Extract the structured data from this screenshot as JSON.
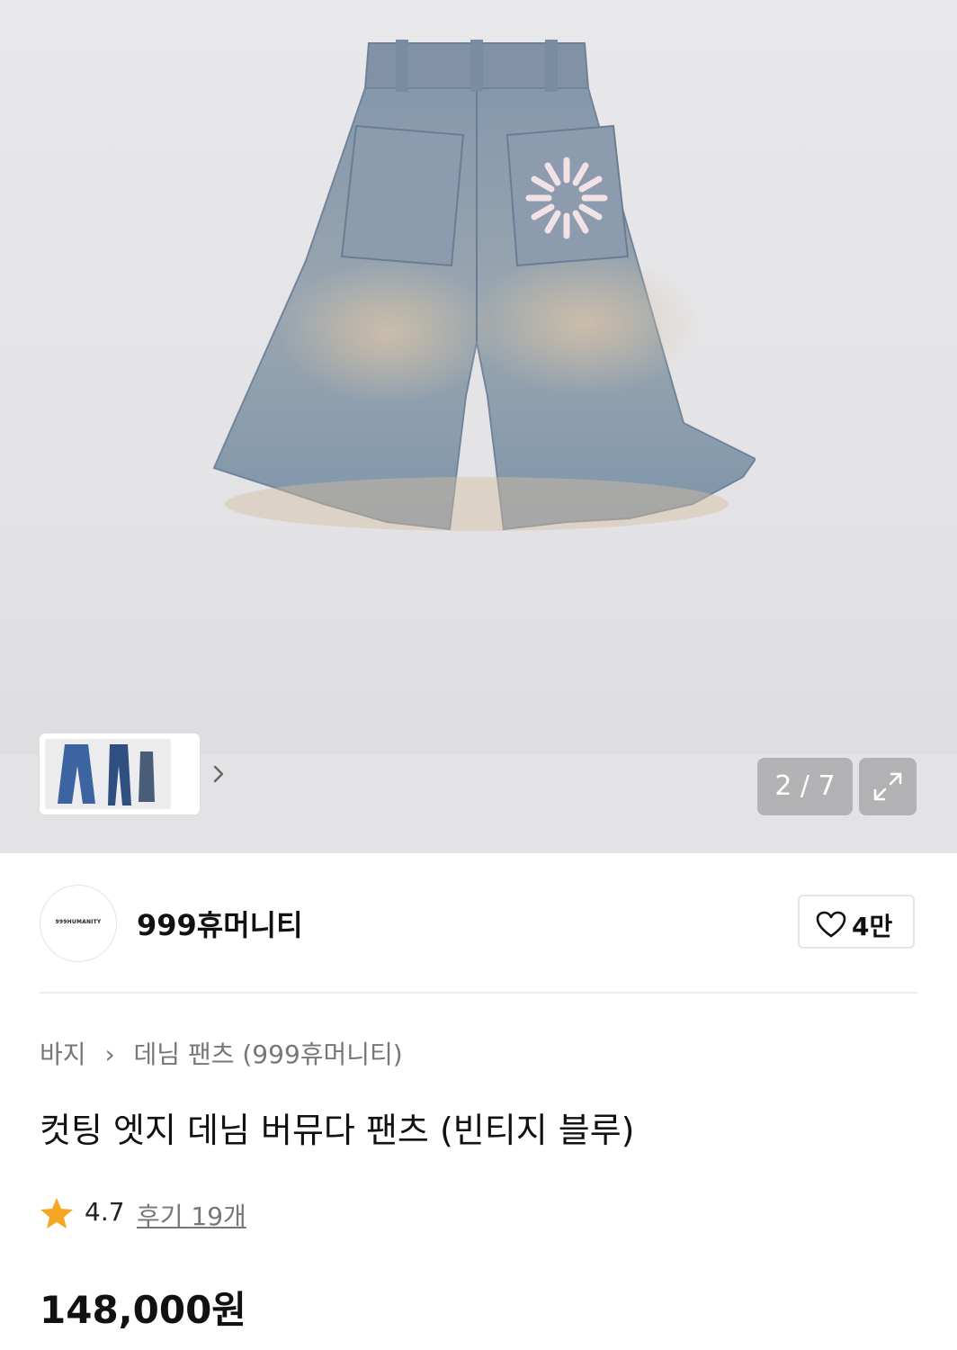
{
  "gallery": {
    "counter": "2 / 7",
    "expand_icon": "expand-icon",
    "thumbnail_next_icon": "chevron-right-icon"
  },
  "brand": {
    "logo_text": "999HUMANITY",
    "name": "999휴머니티"
  },
  "like": {
    "icon": "heart-outline-icon",
    "count": "4만"
  },
  "breadcrumb": {
    "items": [
      "바지",
      "데님 팬츠 (999휴머니티)"
    ],
    "separator_icon": "chevron-right-icon"
  },
  "product": {
    "title": "컷팅 엣지 데님 버뮤다 팬츠 (빈티지 블루)",
    "rating": "4.7",
    "reviews_label": "후기 19개",
    "price": "148,000원"
  },
  "colors": {
    "star": "#f5a623",
    "counter_bg": "#b2b2b4"
  }
}
